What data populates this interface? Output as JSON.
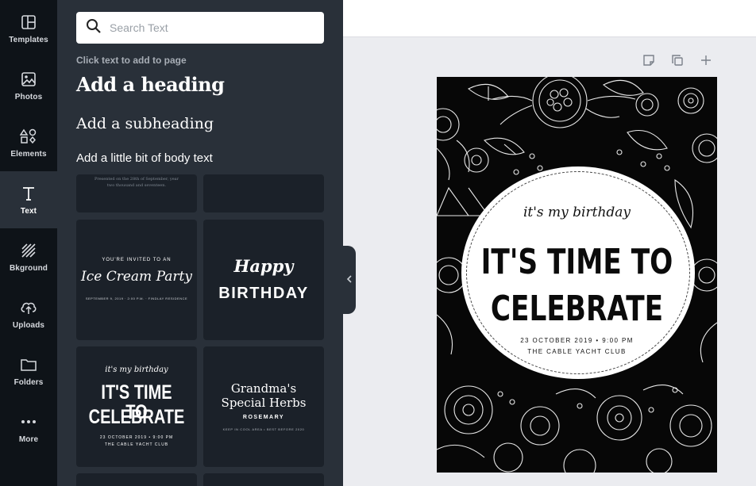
{
  "sidebar": {
    "items": [
      {
        "label": "Templates",
        "icon": "templates-icon"
      },
      {
        "label": "Photos",
        "icon": "photos-icon"
      },
      {
        "label": "Elements",
        "icon": "elements-icon"
      },
      {
        "label": "Text",
        "icon": "text-icon",
        "active": true
      },
      {
        "label": "Bkground",
        "icon": "background-icon"
      },
      {
        "label": "Uploads",
        "icon": "uploads-icon"
      },
      {
        "label": "Folders",
        "icon": "folders-icon"
      },
      {
        "label": "More",
        "icon": "more-icon"
      }
    ]
  },
  "panel": {
    "search_placeholder": "Search Text",
    "hint": "Click text to add to page",
    "add_heading": "Add a heading",
    "add_subheading": "Add a subheading",
    "add_body": "Add a little bit of body text",
    "top_tile_text": "Presented on the 28th of September, year two thousand and seventeen.",
    "templates": [
      {
        "small": "YOU'RE INVITED TO AN",
        "script": "Ice Cream Party",
        "footer": "SEPTEMBER 9, 2019 · 2:00 P.M. · FINDLAY RESIDENCE"
      },
      {
        "script": "Happy",
        "big": "BIRTHDAY"
      },
      {
        "script": "it's my birthday",
        "big1": "IT'S TIME TO",
        "big2": "CELEBRATE",
        "line1": "23 OCTOBER 2019 • 9:00 PM",
        "line2": "THE CABLE YACHT CLUB"
      },
      {
        "title1": "Grandma's",
        "title2": "Special Herbs",
        "sub": "ROSEMARY",
        "footer": "KEEP IN COOL AREA • BEST BEFORE 2020"
      }
    ]
  },
  "design": {
    "script": "it's my birthday",
    "line1": "IT'S TIME TO",
    "line2": "CELEBRATE",
    "date": "23 OCTOBER 2019 • 9:00 PM",
    "venue": "THE CABLE YACHT CLUB"
  },
  "colors": {
    "rail_bg": "#0e1318",
    "panel_bg": "#293039",
    "tile_bg": "#1b2129",
    "workspace_bg": "#ebecf0"
  }
}
